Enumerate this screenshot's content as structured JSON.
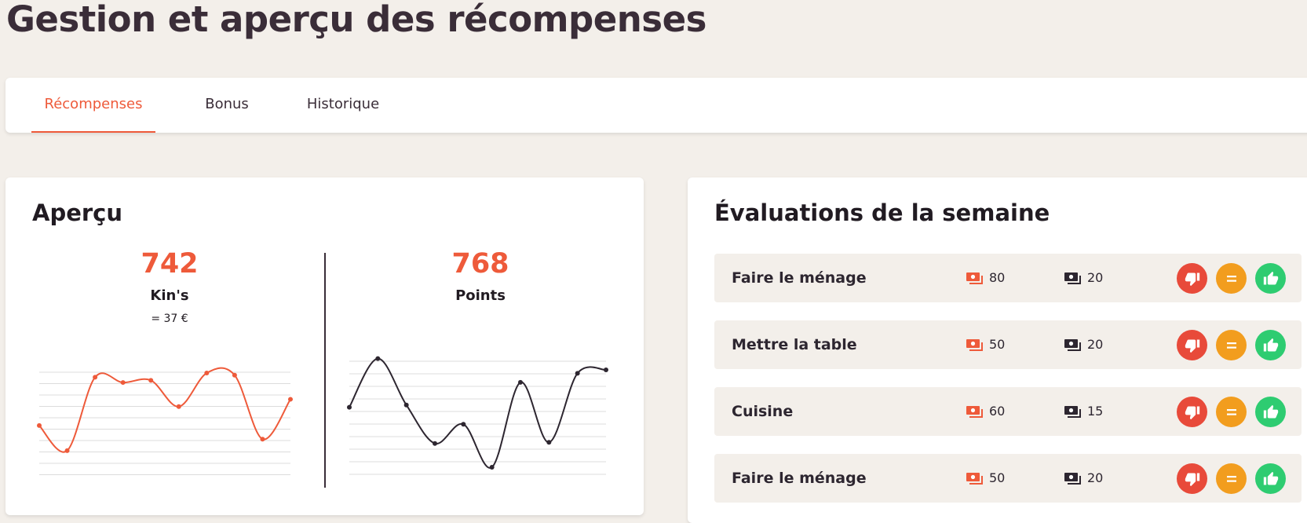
{
  "page": {
    "title": "Gestion et aperçu des récompenses"
  },
  "tabs": [
    {
      "label": "Récompenses",
      "active": true
    },
    {
      "label": "Bonus",
      "active": false
    },
    {
      "label": "Historique",
      "active": false
    }
  ],
  "overview": {
    "title": "Aperçu",
    "kins": {
      "value": "742",
      "label": "Kin's",
      "sub": "= 37 €"
    },
    "points": {
      "value": "768",
      "label": "Points"
    }
  },
  "chart_data": [
    {
      "type": "line",
      "series": [
        {
          "values": [
            6.0,
            3.6,
            10.6,
            10.1,
            10.3,
            7.8,
            11.0,
            10.8,
            4.7,
            8.5
          ]
        }
      ],
      "ylim": [
        0,
        12.5
      ],
      "grid": true,
      "color": "#ee5a3a"
    },
    {
      "type": "line",
      "series": [
        {
          "values": [
            6.9,
            11.2,
            7.1,
            3.7,
            5.4,
            1.6,
            9.1,
            3.8,
            9.9,
            10.2
          ]
        }
      ],
      "ylim": [
        0,
        11.8
      ],
      "grid": true,
      "color": "#2d2630"
    }
  ],
  "weekly": {
    "title": "Évaluations de la semaine",
    "rows": [
      {
        "label": "Faire le ménage",
        "kins": "80",
        "points": "20"
      },
      {
        "label": "Mettre la table",
        "kins": "50",
        "points": "20"
      },
      {
        "label": "Cuisine",
        "kins": "60",
        "points": "15"
      },
      {
        "label": "Faire le ménage",
        "kins": "50",
        "points": "20"
      }
    ]
  },
  "icons": {
    "kins": "money-icon",
    "points": "cash-icon",
    "bad": "thumbs-down-icon",
    "neutral": "equals-icon",
    "good": "thumbs-up-icon"
  },
  "colors": {
    "accent": "#ee5a3a",
    "dark": "#2d2630",
    "background": "#f3efea",
    "bad": "#e84a3a",
    "neutral": "#f29d1e",
    "good": "#2ecc71"
  }
}
